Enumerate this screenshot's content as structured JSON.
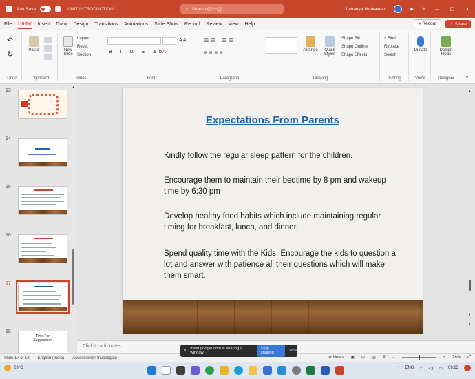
{
  "colors": {
    "accent": "#c8462b",
    "title_blue": "#1f5fb0"
  },
  "titlebar": {
    "autosave": "AutoSave",
    "doc_title": "UNIT INTRODUCTION",
    "search_placeholder": "Search (Alt+Q)",
    "user_name": "Lavanya Venkatesh"
  },
  "menu": {
    "tabs": [
      "File",
      "Home",
      "Insert",
      "Draw",
      "Design",
      "Transitions",
      "Animations",
      "Slide Show",
      "Record",
      "Review",
      "View",
      "Help"
    ],
    "record_label": "Record",
    "share_label": "Share"
  },
  "ribbon": {
    "groups": [
      "Undo",
      "Clipboard",
      "Slides",
      "Font",
      "Paragraph",
      "Drawing",
      "Editing",
      "Voice",
      "Designer"
    ],
    "buttons": {
      "paste": "Paste",
      "new_slide": "New Slide",
      "layout": "Layout",
      "reset": "Reset",
      "section": "Section",
      "arrange": "Arrange",
      "quick_styles": "Quick Styles",
      "shape_fill": "Shape Fill",
      "shape_outline": "Shape Outline",
      "shape_effects": "Shape Effects",
      "find": "Find",
      "replace": "Replace",
      "select": "Select",
      "dictate": "Dictate",
      "design_ideas": "Design Ideas"
    }
  },
  "thumbnails": {
    "numbers": [
      "13",
      "14",
      "15",
      "16",
      "17",
      "18"
    ],
    "selected_index": 4,
    "slide18_text": "Time For Suggestions"
  },
  "slide": {
    "title": "Expectations From Parents",
    "bullets": [
      "Kindly follow the regular sleep pattern for the children.",
      "Encourage them to maintain their bedtime by 8 pm and wakeup time by 6:30 pm",
      "Develop healthy food habits which include maintaining regular timing for breakfast, lunch, and dinner.",
      "Spend quality time with the Kids. Encourage the kids to question a lot and answer with patience all their questions which will make them smart."
    ]
  },
  "notes": {
    "placeholder": "Click to add notes"
  },
  "share_banner": {
    "message": "meet.google.com is sharing a window.",
    "stop_label": "Stop sharing",
    "hide_label": "Hide"
  },
  "statusbar": {
    "slide_count": "Slide 17 of 18",
    "language": "English (India)",
    "accessibility": "Accessibility: Investigate",
    "notes_label": "Notes",
    "zoom": "76%"
  },
  "taskbar": {
    "temperature": "29°C",
    "language": "ENG",
    "time": "09:23"
  }
}
